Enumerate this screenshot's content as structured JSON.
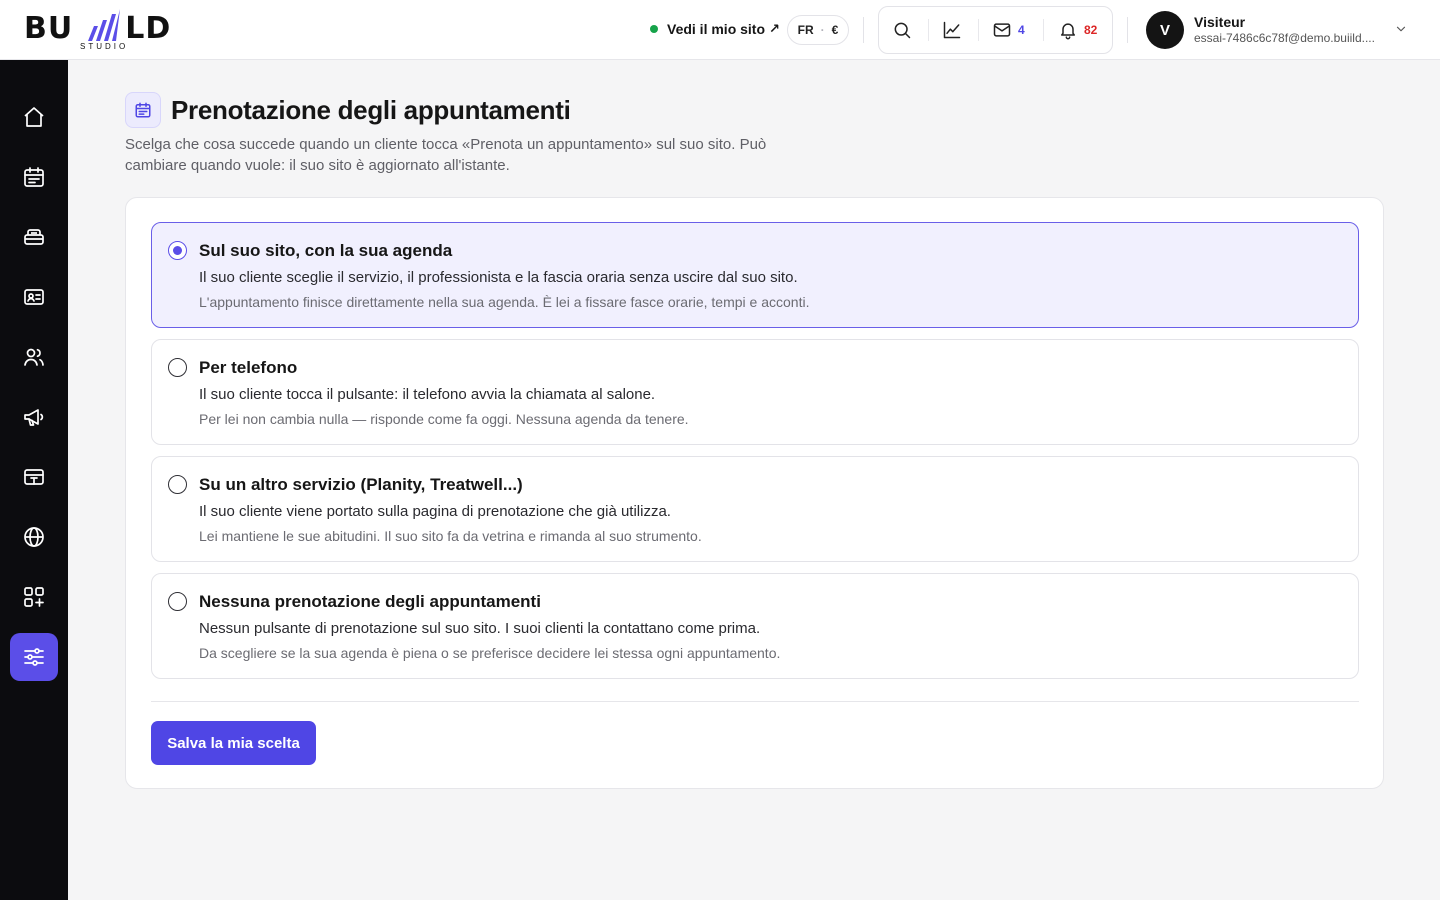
{
  "colors": {
    "accent": "#4f46e5",
    "online": "#16a34a",
    "mail_count": "#4f46e5",
    "alert_count": "#dc2626",
    "sidebar_bg": "#0c0c0f"
  },
  "brand": {
    "word_left": "BU",
    "word_right": "LD",
    "sub": "STUDIO"
  },
  "header": {
    "site_link": "Vedi il mio sito",
    "site_link_arrow": "↗",
    "locale": {
      "language": "FR",
      "currency": "€"
    },
    "tools": {
      "search_icon": "search-icon",
      "stats_icon": "chart-line-icon",
      "mail_count": "4",
      "notification_count": "82"
    },
    "user": {
      "initial": "V",
      "name": "Visiteur",
      "email": "essai-7486c6c78f@demo.buiild...."
    }
  },
  "sidebar": {
    "items": [
      {
        "icon": "home-icon",
        "active": false
      },
      {
        "icon": "calendar-icon",
        "active": false
      },
      {
        "icon": "services-icon",
        "active": false
      },
      {
        "icon": "contact-card-icon",
        "active": false
      },
      {
        "icon": "users-icon",
        "active": false
      },
      {
        "icon": "megaphone-icon",
        "active": false
      },
      {
        "icon": "payment-icon",
        "active": false
      },
      {
        "icon": "globe-icon",
        "active": false
      },
      {
        "icon": "apps-add-icon",
        "active": false
      },
      {
        "icon": "settings-sliders-icon",
        "active": true
      }
    ]
  },
  "page": {
    "title": "Prenotazione degli appuntamenti",
    "description": "Scelga che cosa succede quando un cliente tocca «Prenota un appuntamento» sul suo sito. Può cambiare quando vuole: il suo sito è aggiornato all'istante."
  },
  "options": [
    {
      "title": "Sul suo sito, con la sua agenda",
      "line1": "Il suo cliente sceglie il servizio, il professionista e la fascia oraria senza uscire dal suo sito.",
      "line2": "L'appuntamento finisce direttamente nella sua agenda. È lei a fissare fasce orarie, tempi e acconti.",
      "selected": true
    },
    {
      "title": "Per telefono",
      "line1": "Il suo cliente tocca il pulsante: il telefono avvia la chiamata al salone.",
      "line2": "Per lei non cambia nulla — risponde come fa oggi. Nessuna agenda da tenere.",
      "selected": false
    },
    {
      "title": "Su un altro servizio (Planity, Treatwell...)",
      "line1": "Il suo cliente viene portato sulla pagina di prenotazione che già utilizza.",
      "line2": "Lei mantiene le sue abitudini. Il suo sito fa da vetrina e rimanda al suo strumento.",
      "selected": false
    },
    {
      "title": "Nessuna prenotazione degli appuntamenti",
      "line1": "Nessun pulsante di prenotazione sul suo sito. I suoi clienti la contattano come prima.",
      "line2": "Da scegliere se la sua agenda è piena o se preferisce decidere lei stessa ogni appuntamento.",
      "selected": false
    }
  ],
  "actions": {
    "save_label": "Salva la mia scelta"
  }
}
